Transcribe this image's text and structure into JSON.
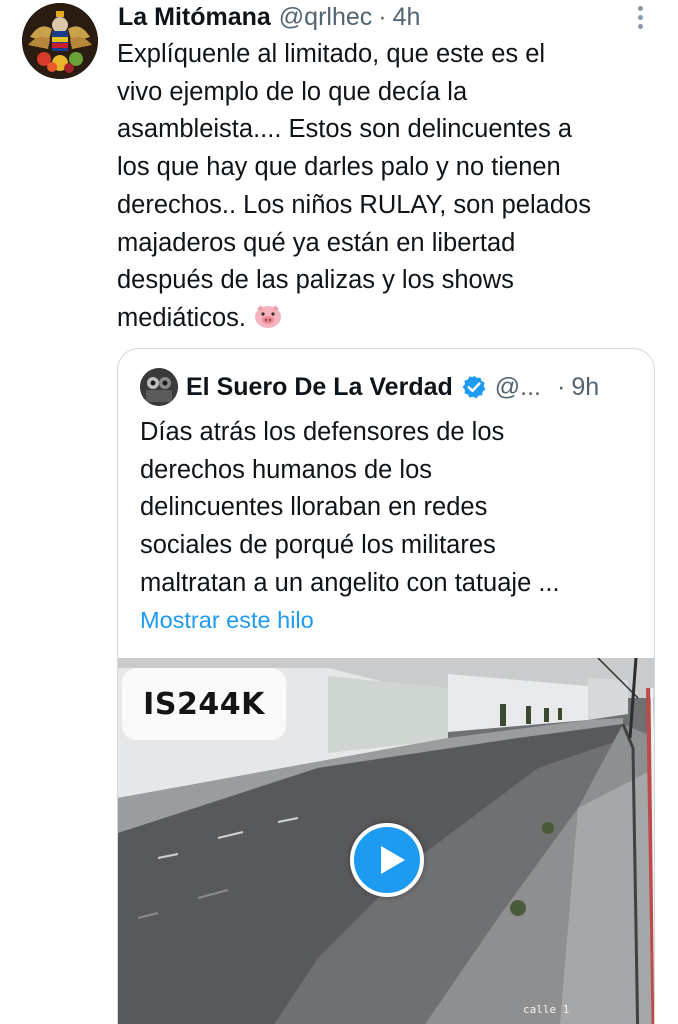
{
  "tweet": {
    "display_name": "La Mitómana",
    "handle": "@qrlhec",
    "separator": "·",
    "time": "4h",
    "text": "Explíquenle al limitado, que este es el\nvivo ejemplo de lo que decía la\nasambleista.... Estos son delincuentes a\nlos que hay que darles palo y no tienen\nderechos.. Los niños RULAY, son pelados\nmajaderos qué ya están en libertad\ndespués de las palizas y los shows\nmediáticos.",
    "emoji_icon": "pig-face-icon"
  },
  "quote": {
    "display_name": "El Suero De La Verdad",
    "handle": "@...",
    "separator": "·",
    "time": "9h",
    "text": "Días atrás los defensores de los\nderechos humanos de los\ndelincuentes lloraban en redes\nsociales de porqué los militares\nmaltratan a un angelito con tatuaje ...",
    "show_thread": "Mostrar este hilo",
    "media": {
      "plate_text": "IS244K",
      "camera_label": "calle 1"
    }
  },
  "colors": {
    "link": "#1d9bf0",
    "secondary_text": "#536471",
    "border": "#cfd9de"
  }
}
